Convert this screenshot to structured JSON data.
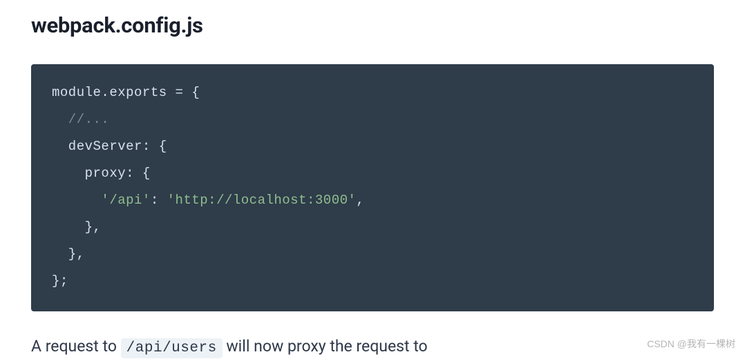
{
  "heading": "webpack.config.js",
  "code": {
    "line1_a": "module",
    "line1_b": ".",
    "line1_c": "exports ",
    "line1_d": "=",
    "line1_e": " {",
    "line2": "  //...",
    "line3_a": "  devServer",
    "line3_b": ":",
    "line3_c": " {",
    "line4_a": "    proxy",
    "line4_b": ":",
    "line4_c": " {",
    "line5_a": "      ",
    "line5_b": "'/api'",
    "line5_c": ":",
    "line5_d": " ",
    "line5_e": "'http://localhost:3000'",
    "line5_f": ",",
    "line6": "    },",
    "line7": "  },",
    "line8": "};"
  },
  "body": {
    "prefix": "A request to ",
    "inline_code": "/api/users",
    "suffix": " will now proxy the request to"
  },
  "watermark": "CSDN @我有一棵树"
}
